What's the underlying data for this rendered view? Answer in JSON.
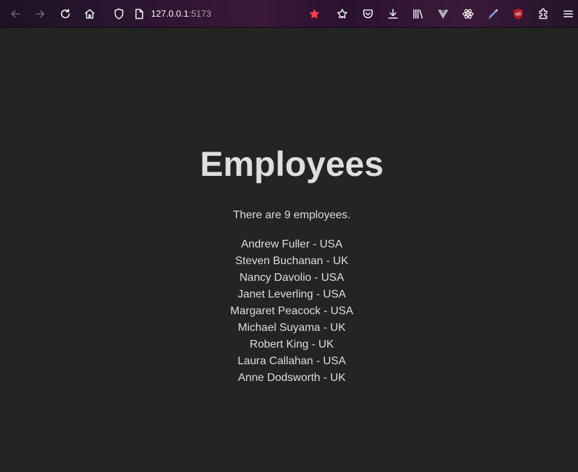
{
  "browser": {
    "url_host": "127.0.0.1",
    "url_port": ":5173",
    "icons": [
      "back-icon",
      "forward-icon",
      "reload-icon",
      "home-icon",
      "shield-icon",
      "page-icon",
      "bookmark-star-icon",
      "reader-icon",
      "pocket-icon",
      "download-icon",
      "library-icon",
      "vue-devtools-icon",
      "react-devtools-icon",
      "color-picker-icon",
      "ublock-icon",
      "extensions-icon",
      "menu-icon"
    ],
    "colors": {
      "bookmark_star": "#ff3c4c",
      "ublock": "#c4161c"
    }
  },
  "page": {
    "title": "Employees",
    "count_text": "There are 9 employees.",
    "employees": [
      "Andrew Fuller - USA",
      "Steven Buchanan - UK",
      "Nancy Davolio - USA",
      "Janet Leverling - USA",
      "Margaret Peacock - USA",
      "Michael Suyama - UK",
      "Robert King - UK",
      "Laura Callahan - USA",
      "Anne Dodsworth - UK"
    ]
  }
}
